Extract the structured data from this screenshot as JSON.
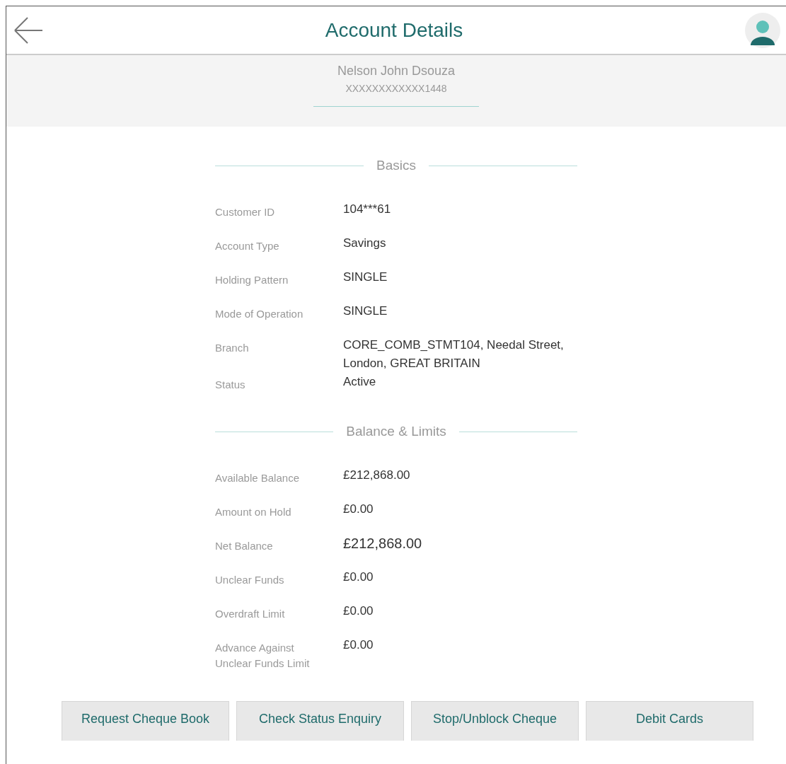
{
  "header": {
    "title": "Account Details"
  },
  "account": {
    "name": "Nelson John Dsouza",
    "number": "XXXXXXXXXXXX1448"
  },
  "sections": [
    {
      "title": "Basics",
      "rows": [
        {
          "label": "Customer ID",
          "value": "104***61",
          "emphasized": false
        },
        {
          "label": "Account Type",
          "value": "Savings",
          "emphasized": false
        },
        {
          "label": "Holding Pattern",
          "value": "SINGLE",
          "emphasized": false
        },
        {
          "label": "Mode of Operation",
          "value": "SINGLE",
          "emphasized": false
        },
        {
          "label": "Branch",
          "value": "CORE_COMB_STMT104, Needal Street, London, GREAT BRITAIN",
          "emphasized": false
        },
        {
          "label": "Status",
          "value": "Active",
          "emphasized": false
        }
      ]
    },
    {
      "title": "Balance & Limits",
      "rows": [
        {
          "label": "Available Balance",
          "value": "£212,868.00",
          "emphasized": false
        },
        {
          "label": "Amount on Hold",
          "value": "£0.00",
          "emphasized": false
        },
        {
          "label": "Net Balance",
          "value": "£212,868.00",
          "emphasized": true
        },
        {
          "label": "Unclear Funds",
          "value": "£0.00",
          "emphasized": false
        },
        {
          "label": "Overdraft Limit",
          "value": "£0.00",
          "emphasized": false
        },
        {
          "label": "Advance Against Unclear Funds Limit",
          "value": "£0.00",
          "emphasized": false
        }
      ]
    }
  ],
  "actions": [
    "Request Cheque Book",
    "Check Status Enquiry",
    "Stop/Unblock Cheque",
    "Debit Cards"
  ]
}
